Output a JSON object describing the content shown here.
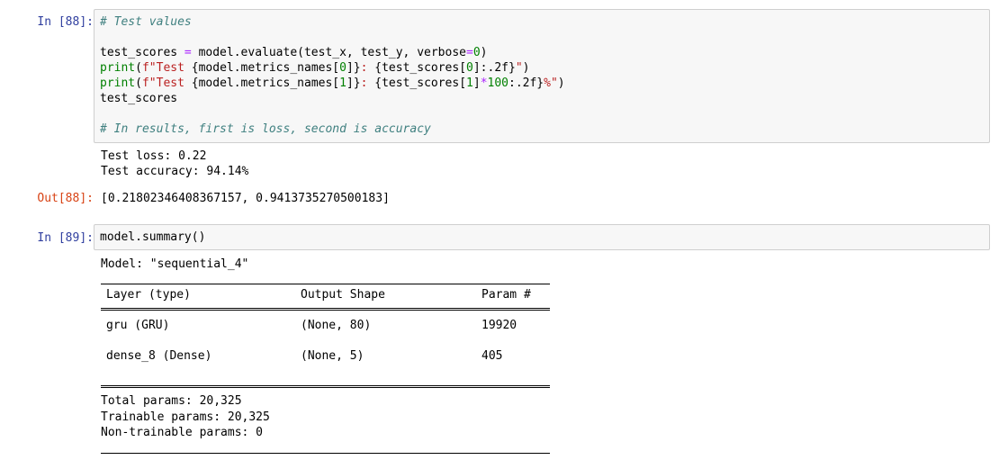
{
  "cells": [
    {
      "prompt": "In [88]:",
      "code": {
        "line1": "# Test values",
        "line3_a": "test_scores ",
        "line3_eq": "=",
        "line3_b": " model.evaluate(test_x, test_y, verbose",
        "line3_eq2": "=",
        "line3_num": "0",
        "line3_c": ")",
        "line4_fn": "print",
        "line4_a": "(",
        "line4_str1": "f\"Test ",
        "line4_b": "{model.metrics_names[",
        "line4_num": "0",
        "line4_c": "]}",
        "line4_str2": ": ",
        "line4_d": "{test_scores[",
        "line4_num2": "0",
        "line4_e": "]:.2f}",
        "line4_str3": "\"",
        "line4_f": ")",
        "line5_fn": "print",
        "line5_a": "(",
        "line5_str1": "f\"Test ",
        "line5_b": "{model.metrics_names[",
        "line5_num": "1",
        "line5_c": "]}",
        "line5_str2": ": ",
        "line5_d": "{test_scores[",
        "line5_num2": "1",
        "line5_e": "]",
        "line5_op": "*",
        "line5_num3": "100",
        "line5_g": ":.2f}",
        "line5_str3": "%\"",
        "line5_h": ")",
        "line6": "test_scores",
        "line8": "# In results, first is loss, second is accuracy"
      },
      "stdout": [
        "Test loss: 0.22",
        "Test accuracy: 94.14%"
      ],
      "out_prompt": "Out[88]:",
      "result": "[0.21802346408367157, 0.9413735270500183]"
    },
    {
      "prompt": "In [89]:",
      "code": "model.summary()",
      "summary": {
        "model_line": "Model: \"sequential_4\"",
        "headers": [
          "Layer (type)",
          "Output Shape",
          "Param #"
        ],
        "rows": [
          [
            "gru (GRU)",
            "(None, 80)",
            "19920"
          ],
          [
            "dense_8 (Dense)",
            "(None, 5)",
            "405"
          ]
        ],
        "totals": [
          "Total params: 20,325",
          "Trainable params: 20,325",
          "Non-trainable params: 0"
        ]
      }
    }
  ],
  "colors": {
    "in_prompt": "#303f9f",
    "out_prompt": "#d84315",
    "cell_background": "#f7f7f7",
    "cell_border": "#cfcfcf",
    "comment": "#408080",
    "string": "#ba2121",
    "number": "#008000",
    "operator": "#aa22ff"
  }
}
